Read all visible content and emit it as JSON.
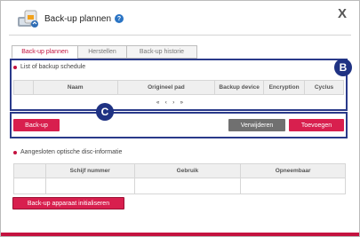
{
  "dialog": {
    "title": "Back-up plannen",
    "help_symbol": "?",
    "close_symbol": "X"
  },
  "tabs": [
    {
      "label": "Back-up plannen",
      "active": true
    },
    {
      "label": "Herstellen",
      "active": false
    },
    {
      "label": "Back-up historie",
      "active": false
    }
  ],
  "schedule": {
    "section_title": "List of backup schedule",
    "columns": [
      "Naam",
      "Origineel pad",
      "Backup device",
      "Encryption",
      "Cyclus"
    ],
    "pager": [
      "«",
      "‹",
      "›",
      "»"
    ]
  },
  "actions": {
    "backup_label": "Back-up",
    "delete_label": "Verwijderen",
    "add_label": "Toevoegen"
  },
  "optical": {
    "section_title": "Aangesloten optische disc-informatie",
    "columns": [
      "Schijf nummer",
      "Gebruik",
      "Opneembaar"
    ]
  },
  "init_button_label": "Back-up apparaat initialiseren",
  "annotations": {
    "b": "B",
    "c": "C"
  },
  "colors": {
    "accent": "#c4123f",
    "badge": "#1f3283",
    "gray_button": "#707070"
  }
}
